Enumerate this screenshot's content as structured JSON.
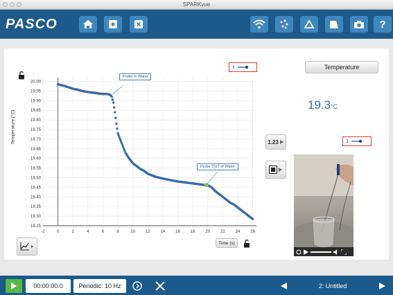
{
  "window": {
    "title": "SPARKvue"
  },
  "toolbar": {
    "logo": "PASCO",
    "buttons": [
      {
        "name": "home-button",
        "icon": "home-icon"
      },
      {
        "name": "sensor-button",
        "icon": "sensor-icon"
      },
      {
        "name": "close-experiment-button",
        "icon": "close-icon"
      },
      {
        "name": "wireless-button",
        "icon": "wireless-icon"
      },
      {
        "name": "data-points-button",
        "icon": "dots-icon"
      },
      {
        "name": "analysis-button",
        "icon": "triangle-icon"
      },
      {
        "name": "journal-button",
        "icon": "journal-icon"
      },
      {
        "name": "camera-button",
        "icon": "camera-icon"
      },
      {
        "name": "help-button",
        "icon": "help-icon",
        "label": "?"
      }
    ]
  },
  "graph": {
    "run_label": "1",
    "x_axis_label": "Time (s)",
    "y_axis_label": "Temperature (°C)",
    "annotations": [
      {
        "text": "Probe in Water"
      },
      {
        "text": "Probe OUT of Water"
      }
    ]
  },
  "chart_data": {
    "type": "scatter",
    "xlabel": "Time (s)",
    "ylabel": "Temperature (°C)",
    "xlim": [
      -2,
      26.5
    ],
    "ylim": [
      19.25,
      20.02
    ],
    "x_ticks": [
      "-2",
      "0",
      "2",
      "4",
      "6",
      "8",
      "10",
      "12",
      "14",
      "16",
      "18",
      "20",
      "22",
      "24",
      "26"
    ],
    "y_ticks": [
      "19.25",
      "19.30",
      "19.35",
      "19.40",
      "19.45",
      "19.50",
      "19.55",
      "19.60",
      "19.65",
      "19.70",
      "19.75",
      "19.80",
      "19.85",
      "19.90",
      "19.95",
      "20.00"
    ],
    "grid": true,
    "series": [
      {
        "color": "#3a6aa8",
        "x": [
          0,
          0.5,
          1,
          1.5,
          2,
          2.5,
          3,
          3.5,
          4,
          4.5,
          5,
          5.5,
          6,
          6.5,
          7,
          7.2,
          7.4,
          7.6,
          7.8,
          8,
          8.5,
          9,
          9.5,
          10,
          10.5,
          11,
          11.5,
          12,
          13,
          14,
          15,
          16,
          17,
          18,
          19,
          19.5,
          20,
          20.5,
          21,
          21.5,
          22,
          22.5,
          23,
          23.5,
          24,
          24.5,
          25,
          25.5,
          26
        ],
        "y": [
          19.985,
          19.98,
          19.975,
          19.968,
          19.962,
          19.958,
          19.953,
          19.948,
          19.945,
          19.942,
          19.94,
          19.937,
          19.935,
          19.935,
          19.93,
          19.92,
          19.89,
          19.84,
          19.78,
          19.73,
          19.68,
          19.63,
          19.6,
          19.575,
          19.56,
          19.545,
          19.535,
          19.52,
          19.505,
          19.495,
          19.487,
          19.48,
          19.475,
          19.47,
          19.465,
          19.462,
          19.46,
          19.45,
          19.43,
          19.415,
          19.4,
          19.385,
          19.37,
          19.36,
          19.345,
          19.33,
          19.315,
          19.3,
          19.285
        ]
      }
    ],
    "highlight_points": [
      {
        "x": 19.8,
        "y": 19.462,
        "color": "#8bc34a"
      }
    ]
  },
  "digits": {
    "title": "Temperature",
    "value": "19.3",
    "unit": "°C"
  },
  "side_controls": {
    "digits_button": "1.23",
    "video_run_label": "1"
  },
  "video": {
    "controls": "video-controls"
  },
  "statusbar": {
    "time": "00:00:00.0",
    "sampling": "Periodic: 10 Hz",
    "page": "2: Untitled"
  }
}
